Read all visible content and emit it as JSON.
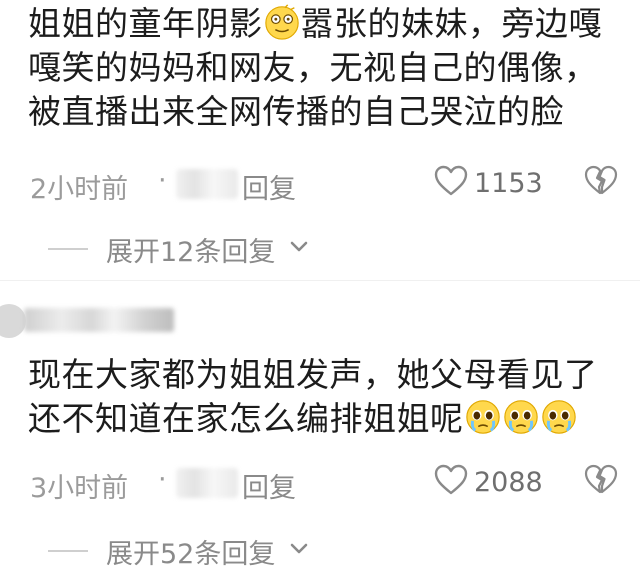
{
  "comments": [
    {
      "text_part1": "姐姐的童年阴影",
      "text_part2": "嚣张的妹妹，旁边嘎嘎笑的妈妈和网友，无视自己的偶像，被直播出来全网传播的自己哭泣的脸",
      "inline_emoji": "dizzy-face-emoji",
      "time": "2小时前",
      "separator": "·",
      "reply_label": "回复",
      "like_count": "1153",
      "expand_label": "展开12条回复"
    },
    {
      "text": "现在大家都为姐姐发声，她父母看见了还不知道在家怎么编排姐姐呢",
      "trailing_emojis": [
        "pleading-face-emoji",
        "pleading-face-emoji",
        "pleading-face-emoji"
      ],
      "time": "3小时前",
      "separator": "·",
      "reply_label": "回复",
      "like_count": "2088",
      "expand_label": "展开52条回复"
    }
  ],
  "icons": {
    "like": "heart-outline-icon",
    "dislike": "broken-heart-outline-icon",
    "expand": "chevron-down-icon"
  },
  "colors": {
    "text": "#1c1c1c",
    "meta": "#9b9b9b",
    "icon": "#8a8a8a",
    "emoji_face": "#ffd84d"
  }
}
